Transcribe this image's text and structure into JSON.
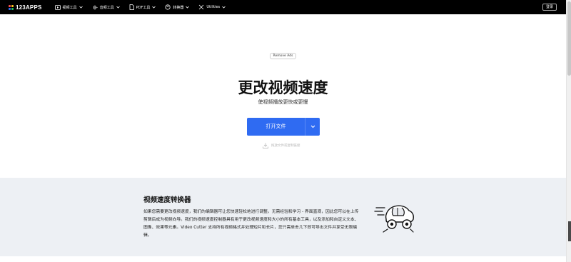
{
  "header": {
    "logo_text": "123APPS",
    "nav": [
      {
        "label": "视频工具",
        "icon": "video-icon"
      },
      {
        "label": "音频工具",
        "icon": "audio-wave-icon"
      },
      {
        "label": "PDF工具",
        "icon": "pdf-file-icon"
      },
      {
        "label": "转换器",
        "icon": "convert-icon"
      },
      {
        "label": "Utilities",
        "icon": "tools-icon"
      }
    ],
    "login_label": "登录"
  },
  "hero": {
    "remove_ads": "Remove Ads",
    "title": "更改视频速度",
    "subtitle": "使视频播放更快或更慢",
    "open_button": "打开文件",
    "drop_hint": "拖放文件或复制链接"
  },
  "info": {
    "title": "视频速度转换器",
    "body": "如果您需要更改视频速度，我们的编辑器可让您快速轻松地进行调整。无需经验和学习 - 界面直观，因此您可以在上传剪辑后成为视频向导。我们的视频速度控制器具有用于更改视频速度和大小的所有基本工具，以及添加和自定义文本、图像、效果等元素。Video Cutter 支持所有视频格式并处理短片和长片，您只需单击几下即可导出文件并享受无限编辑。"
  },
  "colors": {
    "topbar": "#000000",
    "accent": "#2f6bf2",
    "section_bg": "#edf0f4",
    "logo_dots": [
      "#ff4d4d",
      "#ffc21a",
      "#2f6bf2",
      "#22c55e"
    ]
  }
}
